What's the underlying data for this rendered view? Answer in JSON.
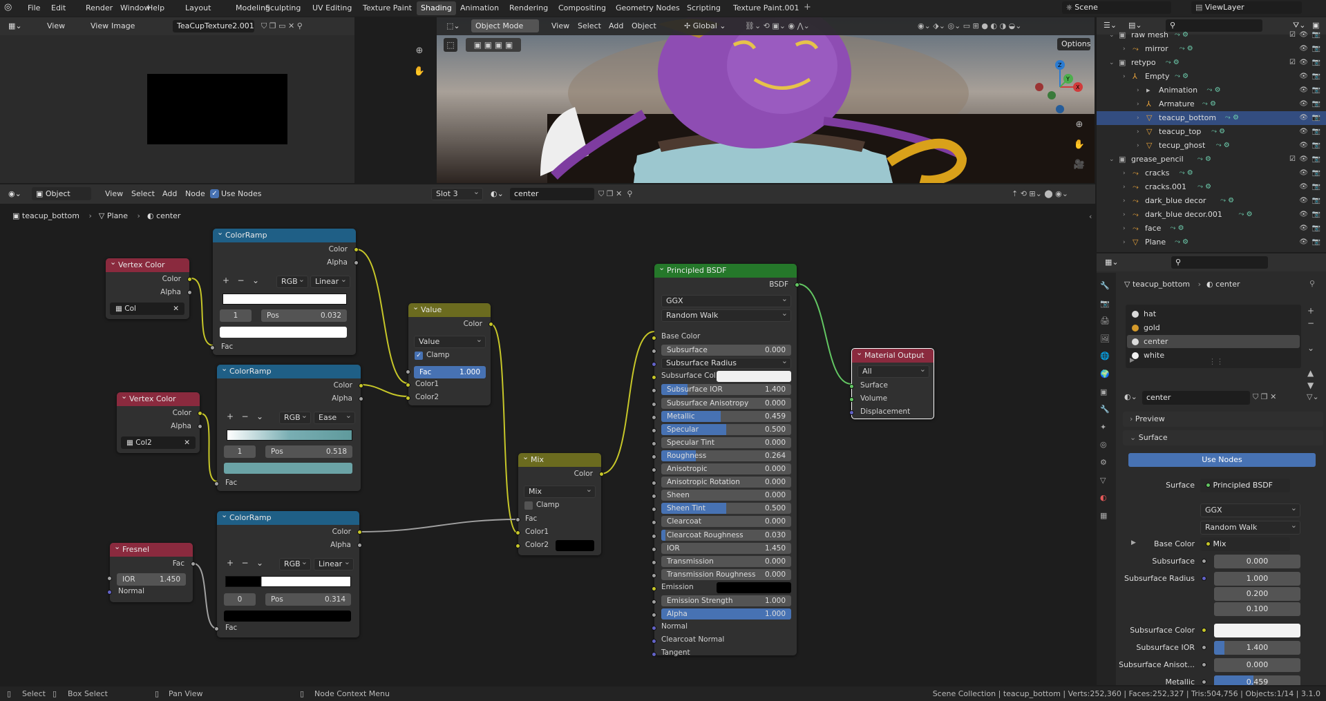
{
  "topbar": {
    "menu": [
      "File",
      "Edit",
      "Render",
      "Window",
      "Help"
    ],
    "workspaces": [
      "Layout",
      "Modeling",
      "Sculpting",
      "UV Editing",
      "Texture Paint",
      "Shading",
      "Animation",
      "Rendering",
      "Compositing",
      "Geometry Nodes",
      "Scripting",
      "Texture Paint.001"
    ],
    "active_workspace": "Shading",
    "scene": "Scene",
    "view_layer": "ViewLayer"
  },
  "image_editor": {
    "menu": [
      "View",
      "View",
      "Image"
    ],
    "image_name": "TeaCupTexture2.001"
  },
  "viewport": {
    "mode": "Object Mode",
    "menu": [
      "View",
      "Select",
      "Add",
      "Object"
    ],
    "orientation": "Global",
    "options": "Options"
  },
  "node_editor": {
    "type": "Object",
    "menu": [
      "View",
      "Select",
      "Add",
      "Node"
    ],
    "use_nodes": "Use Nodes",
    "slot": "Slot 3",
    "material": "center",
    "breadcrumb": [
      "teacup_bottom",
      "Plane",
      "center"
    ]
  },
  "nodes": {
    "vc1": {
      "title": "Vertex Color",
      "color": "Color",
      "alpha": "Alpha",
      "layer": "Col"
    },
    "vc2": {
      "title": "Vertex Color",
      "color": "Color",
      "alpha": "Alpha",
      "layer": "Col2"
    },
    "fresnel": {
      "title": "Fresnel",
      "fac": "Fac",
      "ior_label": "IOR",
      "ior": "1.450",
      "normal": "Normal"
    },
    "cr1": {
      "title": "ColorRamp",
      "color": "Color",
      "alpha": "Alpha",
      "mode": "RGB",
      "interp": "Linear",
      "index": "1",
      "pos_label": "Pos",
      "pos": "0.032",
      "fac": "Fac"
    },
    "cr2": {
      "title": "ColorRamp",
      "color": "Color",
      "alpha": "Alpha",
      "mode": "RGB",
      "interp": "Ease",
      "index": "1",
      "pos_label": "Pos",
      "pos": "0.518",
      "fac": "Fac"
    },
    "cr3": {
      "title": "ColorRamp",
      "color": "Color",
      "alpha": "Alpha",
      "mode": "RGB",
      "interp": "Linear",
      "index": "0",
      "pos_label": "Pos",
      "pos": "0.314",
      "fac": "Fac"
    },
    "value": {
      "title": "Value",
      "color": "Color",
      "op": "Value",
      "clamp": "Clamp",
      "fac_label": "Fac",
      "fac": "1.000",
      "color1": "Color1",
      "color2": "Color2"
    },
    "mix": {
      "title": "Mix",
      "color": "Color",
      "mode": "Mix",
      "clamp": "Clamp",
      "fac": "Fac",
      "color1": "Color1",
      "color2": "Color2"
    },
    "bsdf": {
      "title": "Principled BSDF",
      "out": "BSDF",
      "dist": "GGX",
      "sss": "Random Walk",
      "rows": [
        {
          "label": "Base Color",
          "value": "",
          "sock": "sy",
          "kind": "label"
        },
        {
          "label": "Subsurface",
          "value": "0.000",
          "sock": "sg",
          "kind": "field",
          "fill": 0
        },
        {
          "label": "Subsurface Radius",
          "value": "",
          "sock": "sb",
          "kind": "dd"
        },
        {
          "label": "Subsurface Col...",
          "value": "",
          "sock": "sy",
          "kind": "color"
        },
        {
          "label": "Subsurface IOR",
          "value": "1.400",
          "sock": "sg",
          "kind": "field",
          "fill": 0.2
        },
        {
          "label": "Subsurface Anisotropy",
          "value": "0.000",
          "sock": "sg",
          "kind": "field",
          "fill": 0
        },
        {
          "label": "Metallic",
          "value": "0.459",
          "sock": "sg",
          "kind": "field",
          "fill": 0.459
        },
        {
          "label": "Specular",
          "value": "0.500",
          "sock": "sg",
          "kind": "field",
          "fill": 0.5
        },
        {
          "label": "Specular Tint",
          "value": "0.000",
          "sock": "sg",
          "kind": "field",
          "fill": 0
        },
        {
          "label": "Roughness",
          "value": "0.264",
          "sock": "sg",
          "kind": "field",
          "fill": 0.264
        },
        {
          "label": "Anisotropic",
          "value": "0.000",
          "sock": "sg",
          "kind": "field",
          "fill": 0
        },
        {
          "label": "Anisotropic Rotation",
          "value": "0.000",
          "sock": "sg",
          "kind": "field",
          "fill": 0
        },
        {
          "label": "Sheen",
          "value": "0.000",
          "sock": "sg",
          "kind": "field",
          "fill": 0
        },
        {
          "label": "Sheen Tint",
          "value": "0.500",
          "sock": "sg",
          "kind": "field",
          "fill": 0.5
        },
        {
          "label": "Clearcoat",
          "value": "0.000",
          "sock": "sg",
          "kind": "field",
          "fill": 0
        },
        {
          "label": "Clearcoat Roughness",
          "value": "0.030",
          "sock": "sg",
          "kind": "field",
          "fill": 0.03
        },
        {
          "label": "IOR",
          "value": "1.450",
          "sock": "sg",
          "kind": "field",
          "fill": 0
        },
        {
          "label": "Transmission",
          "value": "0.000",
          "sock": "sg",
          "kind": "field",
          "fill": 0
        },
        {
          "label": "Transmission Roughness",
          "value": "0.000",
          "sock": "sg",
          "kind": "field",
          "fill": 0
        },
        {
          "label": "Emission",
          "value": "",
          "sock": "sy",
          "kind": "black"
        },
        {
          "label": "Emission Strength",
          "value": "1.000",
          "sock": "sg",
          "kind": "field",
          "fill": 0
        },
        {
          "label": "Alpha",
          "value": "1.000",
          "sock": "sg",
          "kind": "field",
          "fill": 1
        },
        {
          "label": "Normal",
          "value": "",
          "sock": "sb",
          "kind": "label"
        },
        {
          "label": "Clearcoat Normal",
          "value": "",
          "sock": "sb",
          "kind": "label"
        },
        {
          "label": "Tangent",
          "value": "",
          "sock": "sb",
          "kind": "label"
        }
      ]
    },
    "output": {
      "title": "Material Output",
      "target": "All",
      "surface": "Surface",
      "volume": "Volume",
      "displacement": "Displacement"
    }
  },
  "outliner": {
    "rows": [
      {
        "name": "raw mesh",
        "indent": 0
      },
      {
        "name": "mirror",
        "indent": 1
      },
      {
        "name": "retypo",
        "indent": 0
      },
      {
        "name": "Empty",
        "indent": 1
      },
      {
        "name": "Animation",
        "indent": 2
      },
      {
        "name": "Armature",
        "indent": 2
      },
      {
        "name": "teacup_bottom",
        "indent": 2,
        "selected": true
      },
      {
        "name": "teacup_top",
        "indent": 2
      },
      {
        "name": "tecup_ghost",
        "indent": 2
      },
      {
        "name": "grease_pencil",
        "indent": 0
      },
      {
        "name": "cracks",
        "indent": 1
      },
      {
        "name": "cracks.001",
        "indent": 1
      },
      {
        "name": "dark_blue decor",
        "indent": 1
      },
      {
        "name": "dark_blue decor.001",
        "indent": 1
      },
      {
        "name": "face",
        "indent": 1
      },
      {
        "name": "Plane",
        "indent": 1
      }
    ]
  },
  "properties": {
    "object": "teacup_bottom",
    "material": "center",
    "slots": [
      "hat",
      "gold",
      "center",
      "white"
    ],
    "active_slot": "center",
    "preview": "Preview",
    "surface_panel": "Surface",
    "use_nodes": "Use Nodes",
    "surface_label": "Surface",
    "surface_value": "Principled BSDF",
    "dist": "GGX",
    "sss": "Random Walk",
    "base_color_label": "Base Color",
    "base_color_value": "Mix",
    "subsurface_label": "Subsurface",
    "subsurface_value": "0.000",
    "radius_label": "Subsurface Radius",
    "radius": [
      "1.000",
      "0.200",
      "0.100"
    ],
    "sub_color_label": "Subsurface Color",
    "sub_ior_label": "Subsurface IOR",
    "sub_ior_value": "1.400",
    "sub_aniso_label": "Subsurface Anisot...",
    "sub_aniso_value": "0.000",
    "metallic_label": "Metallic",
    "metallic_value": "0.459"
  },
  "status": {
    "select": "Select",
    "box": "Box Select",
    "pan": "Pan View",
    "ctx": "Node Context Menu",
    "info": "Scene Collection | teacup_bottom | Verts:252,360 | Faces:252,327 | Tris:504,756 | Objects:1/14 | 3.1.0"
  }
}
